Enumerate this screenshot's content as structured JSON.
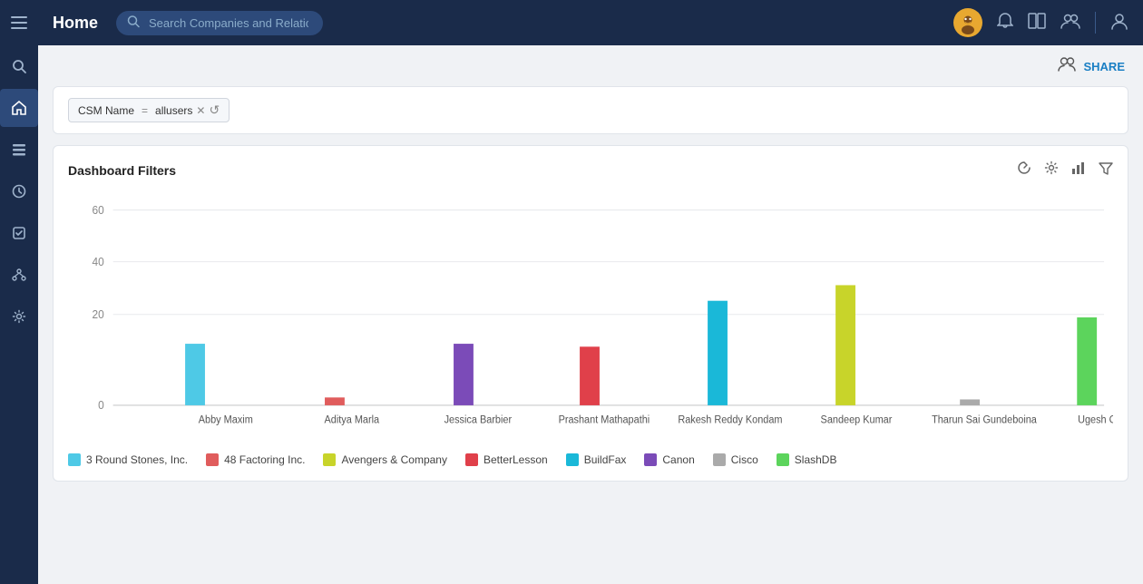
{
  "topnav": {
    "title": "Home",
    "search_placeholder": "Search Companies and Relationships"
  },
  "filter": {
    "label": "CSM Name",
    "operator": "=",
    "value": "allusers"
  },
  "dashboard": {
    "title": "Dashboard Filters",
    "yaxis_labels": [
      "0",
      "20",
      "40",
      "60"
    ],
    "x_labels": [
      "Abby Maxim",
      "Aditya Marla",
      "Jessica Barbier",
      "Prashant Mathapathi",
      "Rakesh Reddy Kondam",
      "Sandeep Kumar",
      "Tharun Sai Gundeboina",
      "Ugesh Gali"
    ],
    "legend": [
      {
        "name": "3 Round Stones, Inc.",
        "color": "#4ec9e6"
      },
      {
        "name": "48 Factoring Inc.",
        "color": "#e05c5c"
      },
      {
        "name": "Avengers & Company",
        "color": "#c8d42a"
      },
      {
        "name": "BetterLesson",
        "color": "#e0404a"
      },
      {
        "name": "BuildFax",
        "color": "#1ab8d8"
      },
      {
        "name": "Canon",
        "color": "#7b4bb8"
      },
      {
        "name": "Cisco",
        "color": "#aaaaaa"
      },
      {
        "name": "SlashDB",
        "color": "#5cd45c"
      }
    ]
  },
  "sidebar": {
    "icons": [
      "☰",
      "🔍",
      "🏠",
      "📋",
      "🕐",
      "✅",
      "🔗",
      "⚙️"
    ]
  },
  "topbar": {
    "share_label": "SHARE"
  }
}
